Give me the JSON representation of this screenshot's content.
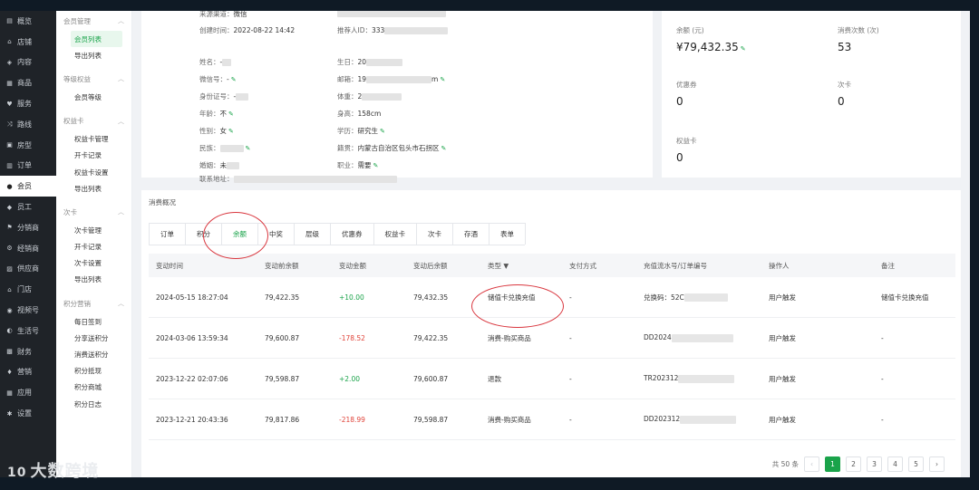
{
  "nav": {
    "items": [
      {
        "label": "概览",
        "icon": "dashboard-icon"
      },
      {
        "label": "店铺",
        "icon": "store-icon"
      },
      {
        "label": "内容",
        "icon": "content-icon"
      },
      {
        "label": "商品",
        "icon": "product-icon"
      },
      {
        "label": "服务",
        "icon": "service-icon"
      },
      {
        "label": "路线",
        "icon": "route-icon"
      },
      {
        "label": "房型",
        "icon": "room-icon"
      },
      {
        "label": "订单",
        "icon": "order-icon"
      },
      {
        "label": "会员",
        "icon": "member-icon"
      },
      {
        "label": "员工",
        "icon": "staff-icon"
      },
      {
        "label": "分销商",
        "icon": "distributor-icon"
      },
      {
        "label": "经销商",
        "icon": "dealer-icon"
      },
      {
        "label": "供应商",
        "icon": "supplier-icon"
      },
      {
        "label": "门店",
        "icon": "shop-icon"
      },
      {
        "label": "视频号",
        "icon": "video-icon"
      },
      {
        "label": "生活号",
        "icon": "life-icon"
      },
      {
        "label": "财务",
        "icon": "finance-icon"
      },
      {
        "label": "营销",
        "icon": "marketing-icon"
      },
      {
        "label": "应用",
        "icon": "apps-icon"
      },
      {
        "label": "设置",
        "icon": "settings-icon"
      }
    ],
    "active_index": 8
  },
  "subnav": {
    "groups": [
      {
        "title": "会员管理",
        "items": [
          "会员列表",
          "导出列表"
        ]
      },
      {
        "title": "等级权益",
        "items": [
          "会员等级"
        ]
      },
      {
        "title": "权益卡",
        "items": [
          "权益卡管理",
          "开卡记录",
          "权益卡设置",
          "导出列表"
        ]
      },
      {
        "title": "次卡",
        "items": [
          "次卡管理",
          "开卡记录",
          "次卡设置",
          "导出列表"
        ]
      },
      {
        "title": "积分营销",
        "items": [
          "每日签到",
          "分享送积分",
          "消费送积分",
          "积分抵现",
          "积分商城",
          "积分日志"
        ]
      }
    ]
  },
  "info": {
    "source_label": "来源渠道：",
    "source_value": "微信",
    "created_label": "创建时间：",
    "created_value": "2022-08-22 14:42",
    "referrer_label": "推荐人ID：",
    "referrer_value": "333",
    "name_label": "姓名：",
    "name_value": "-",
    "birthday_label": "生日：",
    "birthday_value": "20",
    "wechat_label": "微信号：",
    "wechat_value": "-",
    "email_label": "邮箱：",
    "email_value_start": "19",
    "email_value_end": "m",
    "idcard_label": "身份证号：",
    "idcard_value": "-",
    "weight_label": "体重：",
    "weight_value": "2",
    "age_label": "年龄：",
    "age_value": "不",
    "height_label": "身高：",
    "height_value": "158cm",
    "gender_label": "性别：",
    "gender_value": "女",
    "education_label": "学历：",
    "education_value": "研究生",
    "ethnicity_label": "民族：",
    "ethnicity_value": "",
    "hometown_label": "籍贯：",
    "hometown_value": "内蒙古自治区包头市石拐区",
    "marital_label": "婚姻：",
    "marital_value": "未",
    "occupation_label": "职业：",
    "occupation_value": "需要",
    "address_label": "联系地址：",
    "address_value": ""
  },
  "stats": {
    "balance_label": "余额 (元)",
    "balance_value": "¥79,432.35",
    "consume_count_label": "消费次数 (次)",
    "consume_count_value": "53",
    "coupon_label": "优惠券",
    "coupon_value": "0",
    "times_card_label": "次卡",
    "times_card_value": "0",
    "benefit_card_label": "权益卡",
    "benefit_card_value": "0"
  },
  "overview": {
    "title": "消费概况",
    "tabs": [
      "订单",
      "积分",
      "余额",
      "中奖",
      "层级",
      "优惠券",
      "权益卡",
      "次卡",
      "存酒",
      "表单"
    ],
    "active_tab": 2
  },
  "table": {
    "headers": [
      "变动时间",
      "变动前余额",
      "变动金额",
      "变动后余额",
      "类型 ▼",
      "支付方式",
      "充值流水号/订单编号",
      "操作人",
      "备注"
    ],
    "rows": [
      {
        "time": "2024-05-15 18:27:04",
        "before": "79,422.35",
        "amount": "+10.00",
        "after": "79,432.35",
        "type": "储值卡兑换充值",
        "pay": "-",
        "serial": "兑换码：52C",
        "operator": "用户触发",
        "remark": "储值卡兑换充值",
        "sign": "pos"
      },
      {
        "time": "2024-03-06 13:59:34",
        "before": "79,600.87",
        "amount": "-178.52",
        "after": "79,422.35",
        "type": "消费-购买商品",
        "pay": "-",
        "serial": "DD2024",
        "operator": "用户触发",
        "remark": "-",
        "sign": "neg"
      },
      {
        "time": "2023-12-22 02:07:06",
        "before": "79,598.87",
        "amount": "+2.00",
        "after": "79,600.87",
        "type": "退款",
        "pay": "-",
        "serial": "TR202312",
        "operator": "用户触发",
        "remark": "-",
        "sign": "pos"
      },
      {
        "time": "2023-12-21 20:43:36",
        "before": "79,817.86",
        "amount": "-218.99",
        "after": "79,598.87",
        "type": "消费-购买商品",
        "pay": "-",
        "serial": "DD202312",
        "operator": "用户触发",
        "remark": "-",
        "sign": "neg"
      }
    ]
  },
  "pager": {
    "total": "共 50 条",
    "prev": "‹",
    "next": "›",
    "pages": [
      "1",
      "2",
      "3",
      "4",
      "5"
    ],
    "active_page": 0
  },
  "watermark": {
    "text": "大数跨境",
    "logo": "10"
  },
  "colors": {
    "accent": "#1aa34a",
    "negative": "#e0443a",
    "annotation": "#d9363e"
  }
}
